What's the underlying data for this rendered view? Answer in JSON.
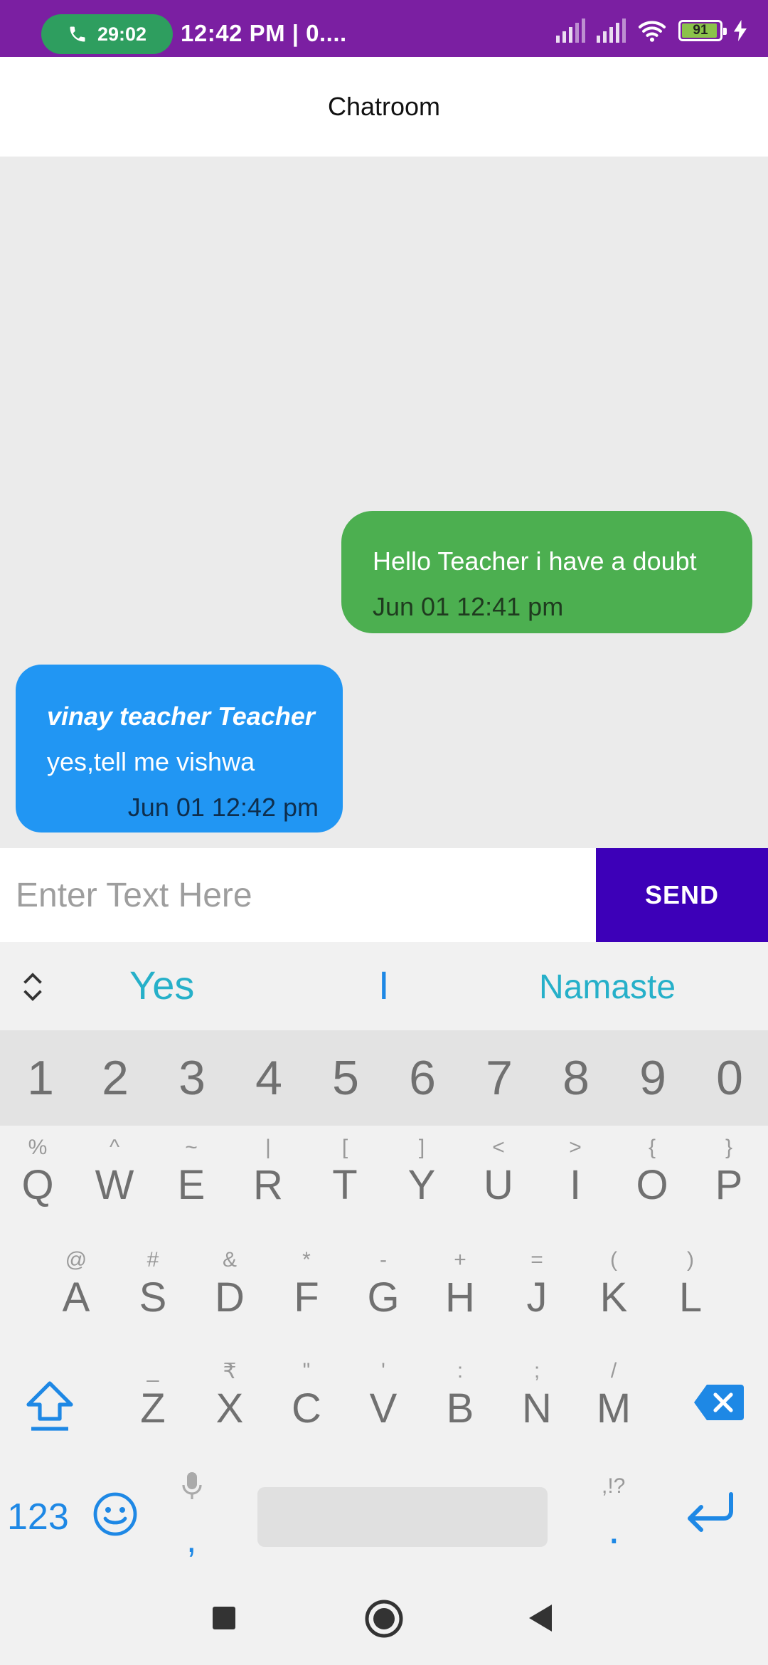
{
  "status_bar": {
    "call_timer": "29:02",
    "time": "12:42 PM | 0....",
    "battery": "91"
  },
  "app_bar": {
    "title": "Chatroom"
  },
  "messages": [
    {
      "direction": "outgoing",
      "text": "Hello Teacher i have a doubt",
      "time": "Jun 01 12:41 pm",
      "color": "#4caf50"
    },
    {
      "direction": "incoming",
      "sender": "vinay teacher Teacher",
      "text": "yes,tell me vishwa",
      "time": "Jun 01 12:42 pm",
      "color": "#2196f3"
    }
  ],
  "composer": {
    "placeholder": "Enter Text Here",
    "send_label": "SEND",
    "send_color": "#3d00b8"
  },
  "keyboard": {
    "suggestions": [
      "Yes",
      "I",
      "Namaste"
    ],
    "numbers": [
      "1",
      "2",
      "3",
      "4",
      "5",
      "6",
      "7",
      "8",
      "9",
      "0"
    ],
    "row1": [
      [
        "Q",
        "%"
      ],
      [
        "W",
        "^"
      ],
      [
        "E",
        "~"
      ],
      [
        "R",
        "|"
      ],
      [
        "T",
        "["
      ],
      [
        "Y",
        "]"
      ],
      [
        "U",
        "<"
      ],
      [
        "I",
        ">"
      ],
      [
        "O",
        "{"
      ],
      [
        "P",
        "}"
      ]
    ],
    "row2": [
      [
        "A",
        "@"
      ],
      [
        "S",
        "#"
      ],
      [
        "D",
        "&"
      ],
      [
        "F",
        "*"
      ],
      [
        "G",
        "-"
      ],
      [
        "H",
        "+"
      ],
      [
        "J",
        "="
      ],
      [
        "K",
        "("
      ],
      [
        "L",
        ")"
      ]
    ],
    "row3": [
      [
        "Z",
        "_"
      ],
      [
        "X",
        "₹"
      ],
      [
        "C",
        "\""
      ],
      [
        "V",
        "'"
      ],
      [
        "B",
        ":"
      ],
      [
        "N",
        ";"
      ],
      [
        "M",
        "/"
      ]
    ],
    "numbers_toggle": "123",
    "comma": ",",
    "punct_hint": ",!?",
    "period": "."
  }
}
